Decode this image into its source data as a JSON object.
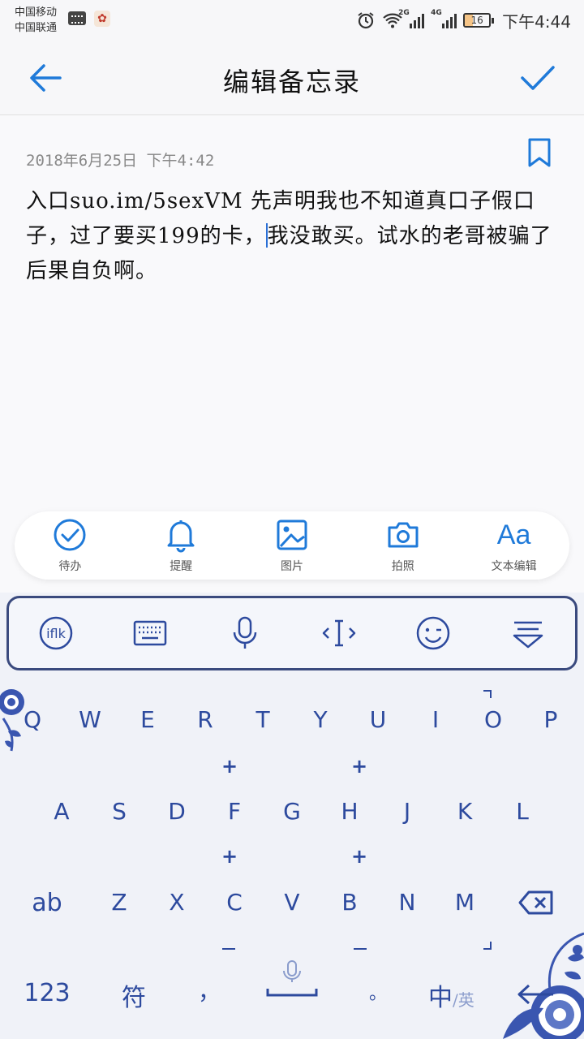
{
  "status_bar": {
    "carrier_1": "中国移动",
    "carrier_2": "中国联通",
    "network_1": "2G",
    "network_2": "4G",
    "battery": "16",
    "time": "下午4:44"
  },
  "header": {
    "title": "编辑备忘录"
  },
  "note": {
    "date": "2018年6月25日 下午4:42",
    "text_before_caret": "入口suo.im/5sexVM   先声明我也不知道真口子假口子，过了要买199的卡，",
    "text_after_caret": "我没敢买。试水的老哥被骗了后果自负啊。"
  },
  "toolbar": {
    "todo": "待办",
    "reminder": "提醒",
    "picture": "图片",
    "camera": "拍照",
    "text_edit": "文本编辑",
    "text_edit_glyph": "Aa"
  },
  "keyboard": {
    "row1": [
      "Q",
      "W",
      "E",
      "R",
      "T",
      "Y",
      "U",
      "I",
      "O",
      "P"
    ],
    "row2": [
      "A",
      "S",
      "D",
      "F",
      "G",
      "H",
      "J",
      "K",
      "L"
    ],
    "row3": [
      "ab",
      "Z",
      "X",
      "C",
      "V",
      "B",
      "N",
      "M"
    ],
    "bottom": {
      "numbers": "123",
      "symbols": "符",
      "comma": "，",
      "period": "。",
      "lang_main": "中",
      "lang_alt": "/英"
    }
  },
  "colors": {
    "accent": "#1f7ad9",
    "keyboard_blue": "#2d4a9e"
  }
}
